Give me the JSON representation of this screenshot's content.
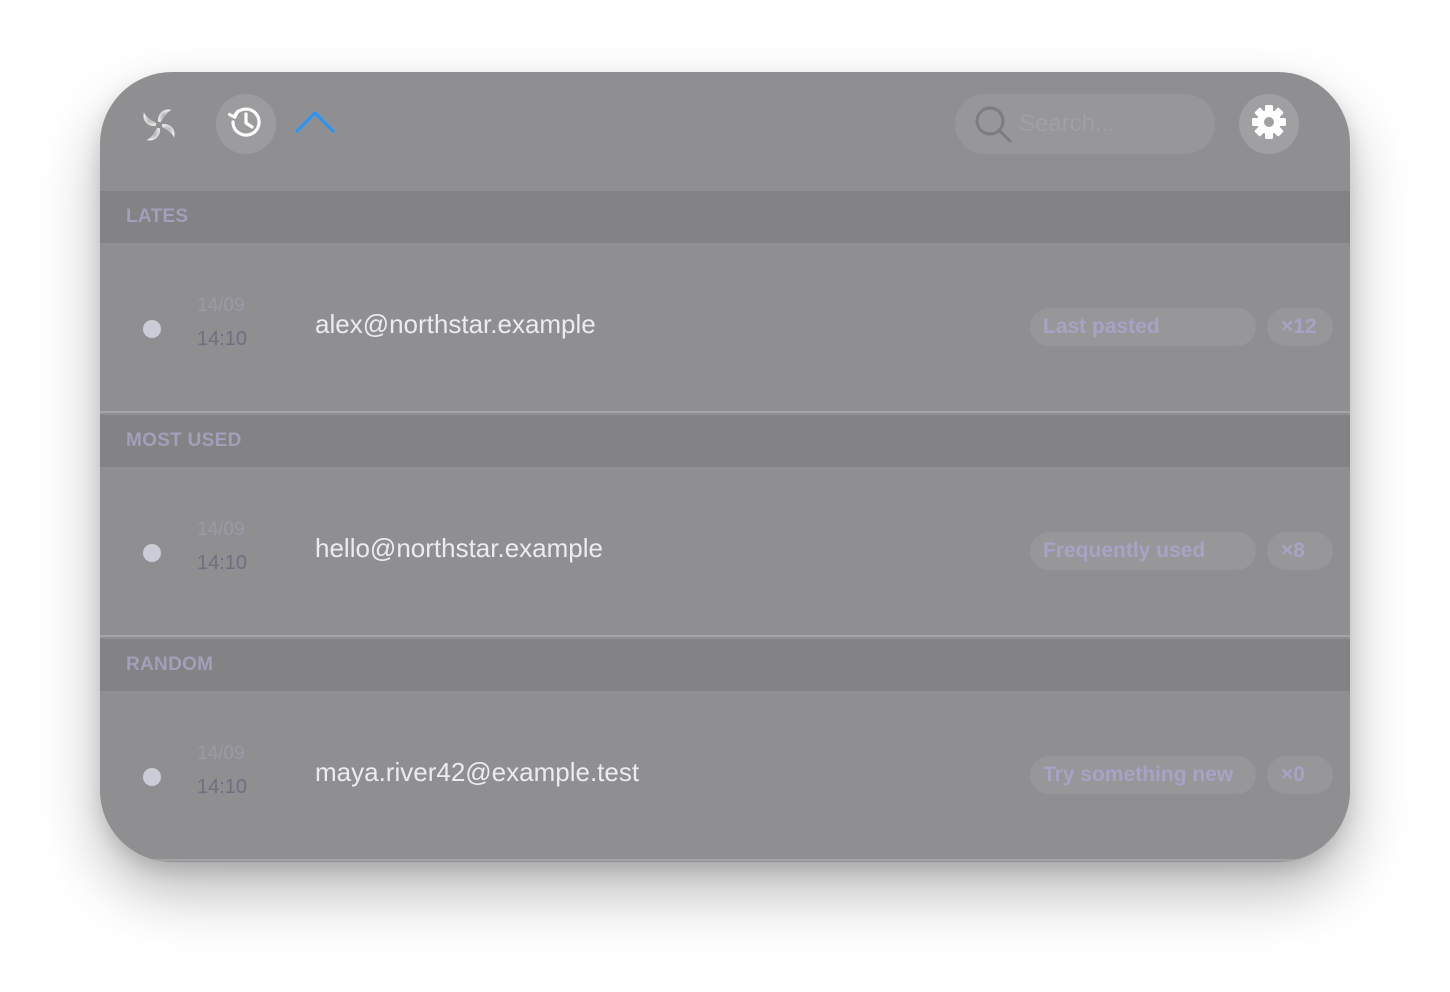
{
  "header": {
    "logo_icon": "swirl-logo-icon",
    "history_icon": "history-icon",
    "collapse_icon": "chevron-up-icon",
    "search": {
      "placeholder": "Search...",
      "value": "",
      "icon": "search-icon"
    },
    "settings_icon": "gear-icon"
  },
  "sections": [
    {
      "title": "LATES",
      "item": {
        "date": "14/09",
        "time": "14:10",
        "email": "alex@northstar.example",
        "tag": "Last pasted",
        "count": "×12"
      }
    },
    {
      "title": "MOST USED",
      "item": {
        "date": "14/09",
        "time": "14:10",
        "email": "hello@northstar.example",
        "tag": "Frequently used",
        "count": "×8"
      }
    },
    {
      "title": "RANDOM",
      "item": {
        "date": "14/09",
        "time": "14:10",
        "email": "maya.river42@example.test",
        "tag": "Try something new",
        "count": "×0"
      }
    }
  ],
  "colors": {
    "window_bg": "#8f8f91",
    "section_bg": "#838385",
    "accent_chevron": "#2b95f4",
    "tag_text": "#a8a2c4",
    "email_text": "#ececf0"
  }
}
